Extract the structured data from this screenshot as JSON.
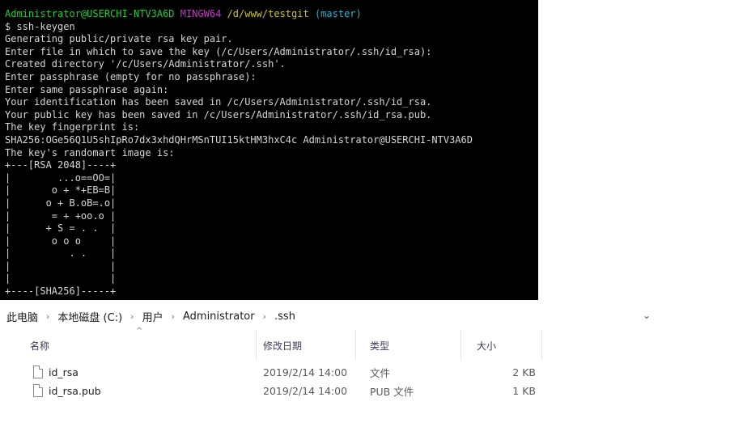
{
  "terminal": {
    "prompt": {
      "user_host": "Administrator@USERCHI-NTV3A6D",
      "shell": "MINGW64",
      "path": "/d/www/testgit",
      "branch": "(master)"
    },
    "command": "$ ssh-keygen",
    "output": [
      "Generating public/private rsa key pair.",
      "Enter file in which to save the key (/c/Users/Administrator/.ssh/id_rsa):",
      "Created directory '/c/Users/Administrator/.ssh'.",
      "Enter passphrase (empty for no passphrase):",
      "Enter same passphrase again:",
      "Your identification has been saved in /c/Users/Administrator/.ssh/id_rsa.",
      "Your public key has been saved in /c/Users/Administrator/.ssh/id_rsa.pub.",
      "The key fingerprint is:",
      "SHA256:OGe56Q1U5shIpRo7dx3xhdQHrMSnTUI15ktHM3hxC4c Administrator@USERCHI-NTV3A6D",
      "The key's randomart image is:",
      "+---[RSA 2048]----+",
      "|        ...o==OO=|",
      "|       o + *+EB=B|",
      "|      o + B.oB=.o|",
      "|       = + +oo.o |",
      "|      + S = . .  |",
      "|       o o o     |",
      "|          . .    |",
      "|                 |",
      "|                 |",
      "+----[SHA256]-----+"
    ]
  },
  "explorer": {
    "breadcrumb": [
      "此电脑",
      "本地磁盘 (C:)",
      "用户",
      "Administrator",
      ".ssh"
    ],
    "breadcrumb_separator": "›",
    "dropdown_glyph": "⌄",
    "sort_glyph": "^",
    "columns": {
      "name": "名称",
      "modified": "修改日期",
      "type": "类型",
      "size": "大小"
    },
    "files": [
      {
        "name": "id_rsa",
        "modified": "2019/2/14 14:00",
        "type": "文件",
        "size": "2 KB"
      },
      {
        "name": "id_rsa.pub",
        "modified": "2019/2/14 14:00",
        "type": "PUB 文件",
        "size": "1 KB"
      }
    ]
  }
}
